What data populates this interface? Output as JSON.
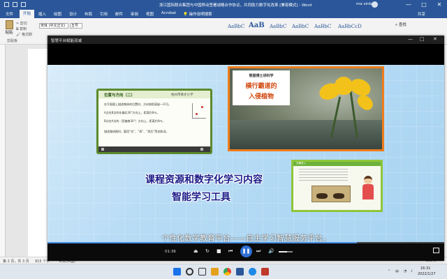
{
  "word": {
    "doc_title": "浙江国际联合集团与中国移动签署战略合作协议，共同助力数字化改革 [兼容模式] - Word",
    "user_name": "ma xinbo",
    "tabs": [
      "文件",
      "开始",
      "插入",
      "绘图",
      "设计",
      "布局",
      "引用",
      "邮件",
      "审阅",
      "视图",
      "Acrobat"
    ],
    "active_tab": "开始",
    "tell_me": "操作说明搜索",
    "share_label": "共享",
    "window_controls": [
      "—",
      "□",
      "✕"
    ],
    "ribbon": {
      "paste": "粘贴",
      "cut": "剪切",
      "copy": "复制",
      "format_painter": "格式刷",
      "clipboard_group": "剪贴板",
      "font_name": "宋体 (中文正文)",
      "font_size": "五号",
      "style_samples": [
        "AaBbC",
        "AaB",
        "AaBbC",
        "AaBbC",
        "AaBbC",
        "AaBbCcD"
      ],
      "find": "查找"
    },
    "status": {
      "page": "第 2 页，共 3 页",
      "words": "915 个字",
      "lang": "中文(中国)",
      "zoom": "100%"
    }
  },
  "player": {
    "title": "智慧平台赋能双减",
    "window_controls": [
      "—",
      "□",
      "✕"
    ],
    "time": "01:36",
    "progress_fraction": 0.78,
    "volume_fraction": 0.6,
    "slide_position": {
      "title": "位置与方向（二）",
      "school_logo": "杭州市育才小学",
      "lines": [
        "在平面图上描述物体的位置时，方向和距离缺一不可。",
        "A点在B点的东偏北30°方向上，距离约Xm。",
        "B点在A点的（西偏南30°）方向上，距离约Xm。",
        "描述路线图时，要用“先”、“再”、“然后”等关联词。"
      ]
    },
    "slide_plant": {
      "badge": "熊猫博士讲科学",
      "title_line1": "横行霸道的",
      "title_line2": "入侵植物"
    },
    "slide_animal": {
      "title": "开篇导入"
    },
    "headline_line1": "课程资源和数字化学习内容",
    "headline_line2": "智能学习工具",
    "subtitle": "个性化数字教育平台——自主学习智慧服务平台，"
  },
  "taskbar": {
    "weather": "",
    "lang": "中",
    "clock_time": "16:31",
    "clock_date": "2022/1/27"
  }
}
